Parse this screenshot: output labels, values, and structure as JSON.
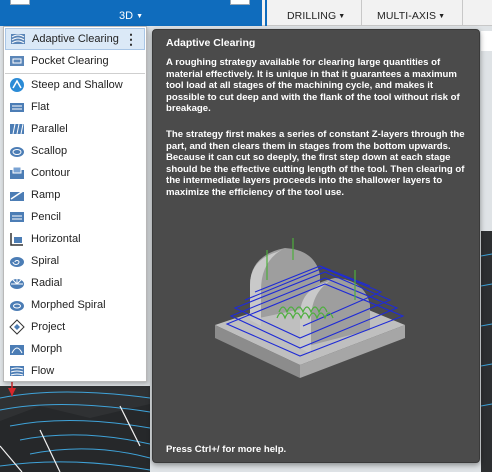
{
  "toolbar": {
    "view_label": "3D",
    "drilling_label": "DRILLING",
    "multiaxis_label": "MULTI-AXIS"
  },
  "menu": {
    "items": [
      {
        "label": "Adaptive Clearing",
        "icon": "adaptive-clearing-icon"
      },
      {
        "label": "Pocket Clearing",
        "icon": "pocket-clearing-icon"
      },
      {
        "label": "Steep and Shallow",
        "icon": "steep-and-shallow-icon"
      },
      {
        "label": "Flat",
        "icon": "flat-icon"
      },
      {
        "label": "Parallel",
        "icon": "parallel-icon"
      },
      {
        "label": "Scallop",
        "icon": "scallop-icon"
      },
      {
        "label": "Contour",
        "icon": "contour-icon"
      },
      {
        "label": "Ramp",
        "icon": "ramp-icon"
      },
      {
        "label": "Pencil",
        "icon": "pencil-icon"
      },
      {
        "label": "Horizontal",
        "icon": "horizontal-icon"
      },
      {
        "label": "Spiral",
        "icon": "spiral-icon"
      },
      {
        "label": "Radial",
        "icon": "radial-icon"
      },
      {
        "label": "Morphed Spiral",
        "icon": "morphed-spiral-icon"
      },
      {
        "label": "Project",
        "icon": "project-icon"
      },
      {
        "label": "Morph",
        "icon": "morph-icon"
      },
      {
        "label": "Flow",
        "icon": "flow-icon"
      }
    ]
  },
  "tooltip": {
    "title": "Adaptive Clearing",
    "paragraph1": "A roughing strategy available for clearing large quantities of material effectively. It is unique in that it guarantees a maximum tool load at all stages of the machining cycle, and makes it possible to cut deep and with the flank of the tool without risk of breakage.",
    "paragraph2": "The strategy first makes a series of constant Z-layers through the part, and then clears them in stages from the bottom upwards. Because it can cut so deeply, the first step down at each stage should be the effective cutting length of the tool. Then clearing of the intermediate layers proceeds into the shallower layers to maximize the efficiency of the tool use.",
    "help_hint": "Press Ctrl+/ for more help."
  },
  "colors": {
    "accent": "#0f6cbd",
    "menu_active_bg": "#dbe9f7",
    "tooltip_bg": "#4b4b4b",
    "toolpath_blue": "#1f2bd6",
    "toolpath_green": "#4caf3c"
  }
}
